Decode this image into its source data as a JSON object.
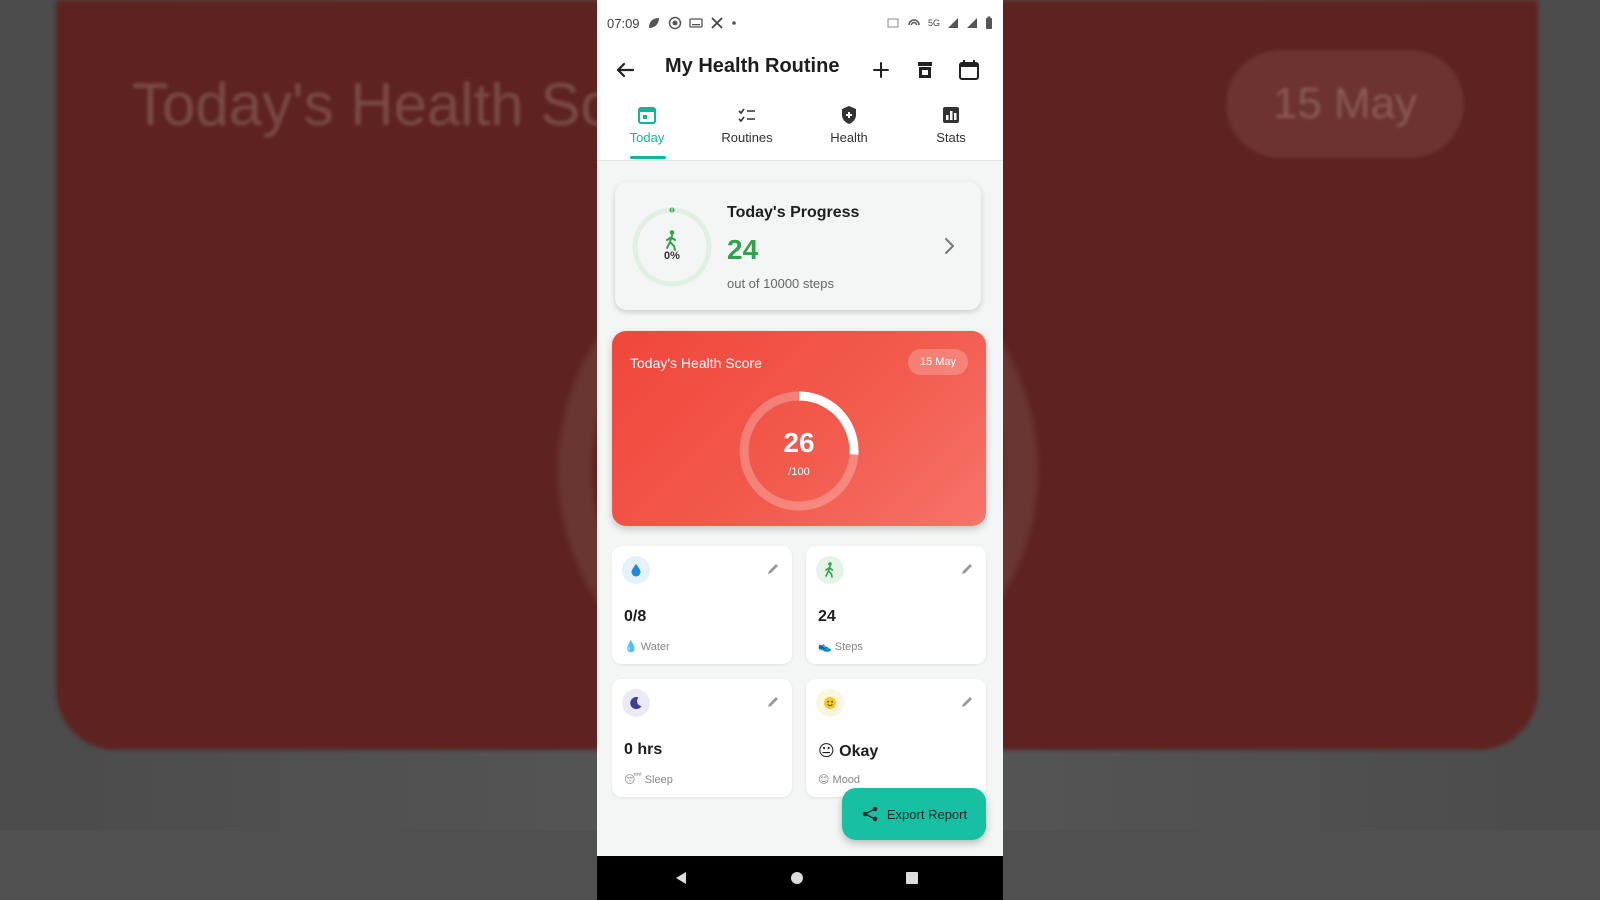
{
  "background": {
    "title": "Today's Health Sc",
    "date": "15 May"
  },
  "status_bar": {
    "time": "07:09",
    "network": "5G"
  },
  "app_bar": {
    "title": "My Health Routine"
  },
  "tabs": [
    {
      "label": "Today",
      "icon": "calendar-icon",
      "active": true
    },
    {
      "label": "Routines",
      "icon": "checklist-icon",
      "active": false
    },
    {
      "label": "Health",
      "icon": "shield-icon",
      "active": false
    },
    {
      "label": "Stats",
      "icon": "bar-chart-icon",
      "active": false
    }
  ],
  "progress_card": {
    "title": "Today's Progress",
    "value": "24",
    "subtitle": "out of 10000 steps",
    "percent_label": "0%",
    "percent": 0
  },
  "score_card": {
    "title": "Today's Health Score",
    "date": "15 May",
    "value": "26",
    "max_label": "/100",
    "score": 26,
    "max": 100
  },
  "tiles": [
    {
      "value": "0/8",
      "label": "Water",
      "icon": "water-drop-icon",
      "label_emoji": "💧"
    },
    {
      "value": "24",
      "label": "Steps",
      "icon": "walking-icon",
      "label_emoji": "👟"
    },
    {
      "value": "0 hrs",
      "label": "Sleep",
      "icon": "moon-icon",
      "label_emoji": "😴"
    },
    {
      "value": "😐 Okay",
      "label": "Mood",
      "icon": "smiley-icon",
      "label_emoji": "😊"
    }
  ],
  "fab": {
    "label": "Export Report"
  },
  "colors": {
    "accent": "#15b39b",
    "score_card": "#f1463c",
    "steps_green": "#2fa34a"
  }
}
